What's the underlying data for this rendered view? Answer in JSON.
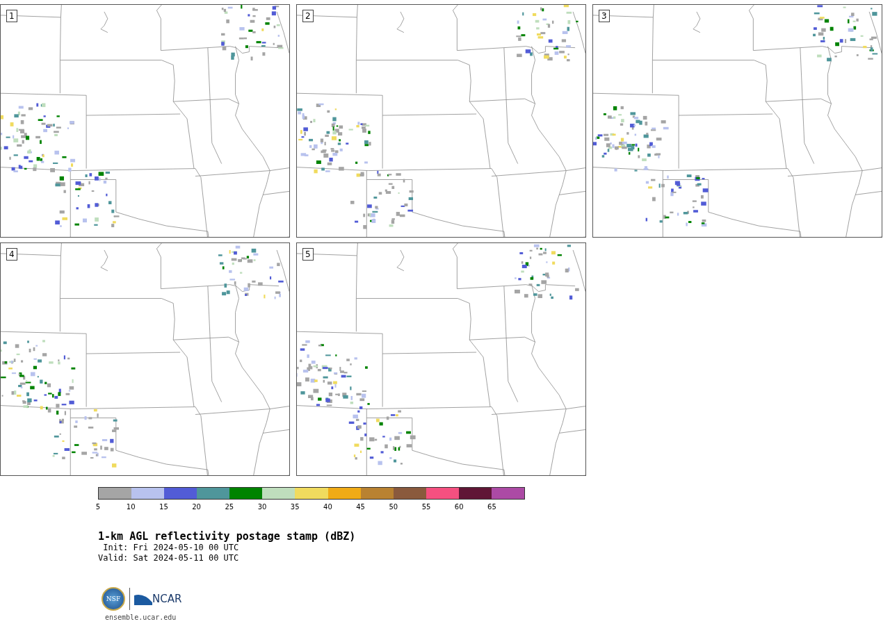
{
  "panels": [
    {
      "label": "1"
    },
    {
      "label": "2"
    },
    {
      "label": "3"
    },
    {
      "label": "4"
    },
    {
      "label": "5"
    }
  ],
  "colorbar": {
    "segments": [
      {
        "color": "#a5a5a5"
      },
      {
        "color": "#b8c2ee"
      },
      {
        "color": "#525cd6"
      },
      {
        "color": "#4f969b"
      },
      {
        "color": "#008300"
      },
      {
        "color": "#bfdebd"
      },
      {
        "color": "#f0db5e"
      },
      {
        "color": "#f0ab16"
      },
      {
        "color": "#b98231"
      },
      {
        "color": "#8a5a3d"
      },
      {
        "color": "#f55080"
      },
      {
        "color": "#601636"
      },
      {
        "color": "#ac4aa5"
      }
    ],
    "ticks": [
      "5",
      "10",
      "15",
      "20",
      "25",
      "30",
      "35",
      "40",
      "45",
      "50",
      "55",
      "60",
      "65"
    ]
  },
  "title": "1-km AGL reflectivity postage stamp (dBZ)",
  "init": " Init: Fri 2024-05-10 00 UTC",
  "valid": "Valid: Sat 2024-05-11 00 UTC",
  "logo": {
    "nsf": "NSF",
    "ncar": "NCAR"
  },
  "url": "ensemble.ucar.edu"
}
